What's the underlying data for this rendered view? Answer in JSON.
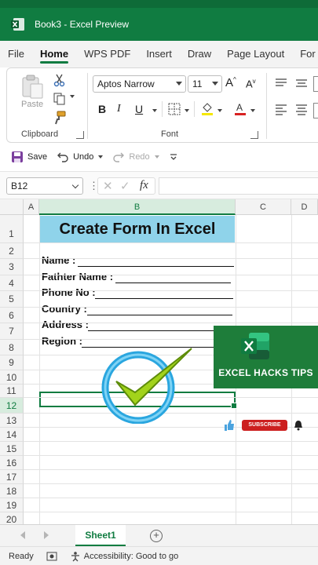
{
  "window": {
    "title": "Book3  -  Excel Preview"
  },
  "ribbon_tabs": [
    "File",
    "Home",
    "WPS PDF",
    "Insert",
    "Draw",
    "Page Layout",
    "For"
  ],
  "active_tab": "Home",
  "ribbon": {
    "paste_label": "Paste",
    "clipboard_label": "Clipboard",
    "font_label": "Font",
    "font_name": "Aptos Narrow",
    "font_size": "11",
    "bold": "B",
    "italic": "I",
    "underline": "U"
  },
  "qat": {
    "save": "Save",
    "undo": "Undo",
    "redo": "Redo"
  },
  "formula_bar": {
    "name_box": "B12",
    "fx": "fx"
  },
  "columns": [
    "A",
    "B",
    "C",
    "D"
  ],
  "rows": [
    "1",
    "2",
    "3",
    "4",
    "5",
    "6",
    "7",
    "8",
    "9",
    "10",
    "11",
    "12",
    "13",
    "14",
    "15",
    "16",
    "17",
    "18",
    "19",
    "20"
  ],
  "selected_row": "12",
  "selected_column": "B",
  "sheet": {
    "heading": "Create Form In Excel",
    "form_fields": [
      "Name :",
      "Fathter Name :",
      "Phone No :",
      "Country :",
      "Address :",
      "Region :"
    ]
  },
  "promo": {
    "text": "EXCEL HACKS TIPS",
    "subscribe": "SUBSCRIBE"
  },
  "sheet_tabs": [
    "Sheet1"
  ],
  "status": {
    "ready": "Ready",
    "accessibility": "Accessibility: Good to go"
  },
  "colors": {
    "excel_green": "#107c41",
    "heading_fill": "#8fd3ea",
    "subscribe_red": "#cc1f1f"
  }
}
